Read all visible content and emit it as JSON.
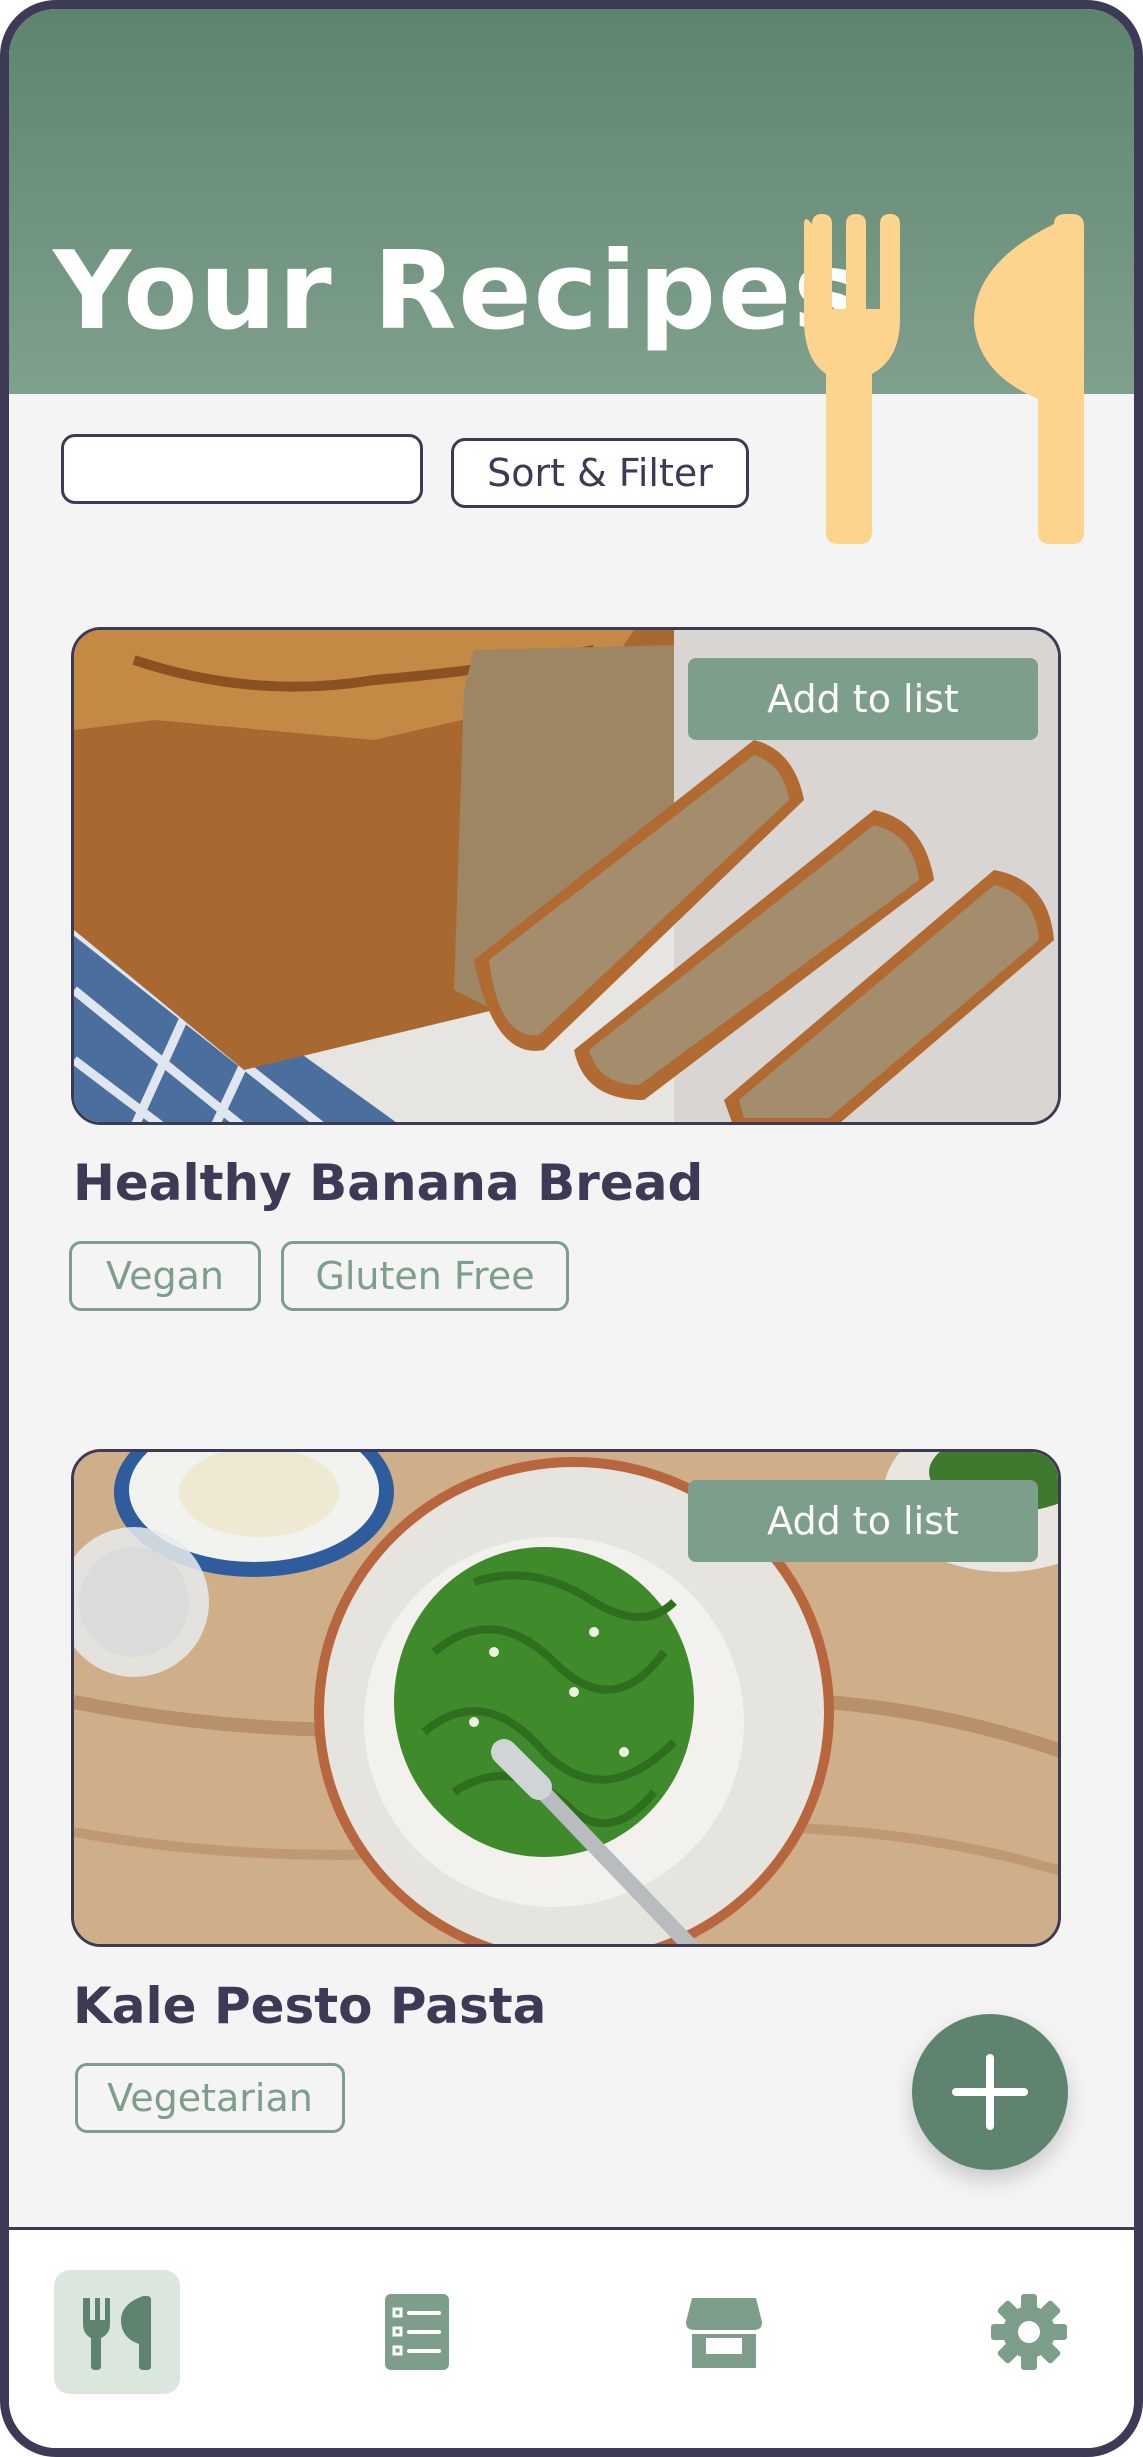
{
  "header": {
    "title": "Your Recipes"
  },
  "search": {
    "placeholder": "",
    "value": ""
  },
  "sort_filter_label": "Sort & Filter",
  "recipes": [
    {
      "title": "Healthy Banana Bread",
      "add_label": "Add to list",
      "tags": [
        "Vegan",
        "Gluten Free"
      ]
    },
    {
      "title": "Kale Pesto Pasta",
      "add_label": "Add to list",
      "tags": [
        "Vegetarian"
      ]
    }
  ],
  "bottom_nav": [
    {
      "icon": "utensils-icon",
      "active": true
    },
    {
      "icon": "list-icon",
      "active": false
    },
    {
      "icon": "store-icon",
      "active": false
    },
    {
      "icon": "gear-icon",
      "active": false
    }
  ],
  "colors": {
    "primary": "#5e8470",
    "accent": "#7c9e8a",
    "text": "#3d3a55",
    "utensils": "#fcd48e",
    "background": "#f4f4f4"
  }
}
